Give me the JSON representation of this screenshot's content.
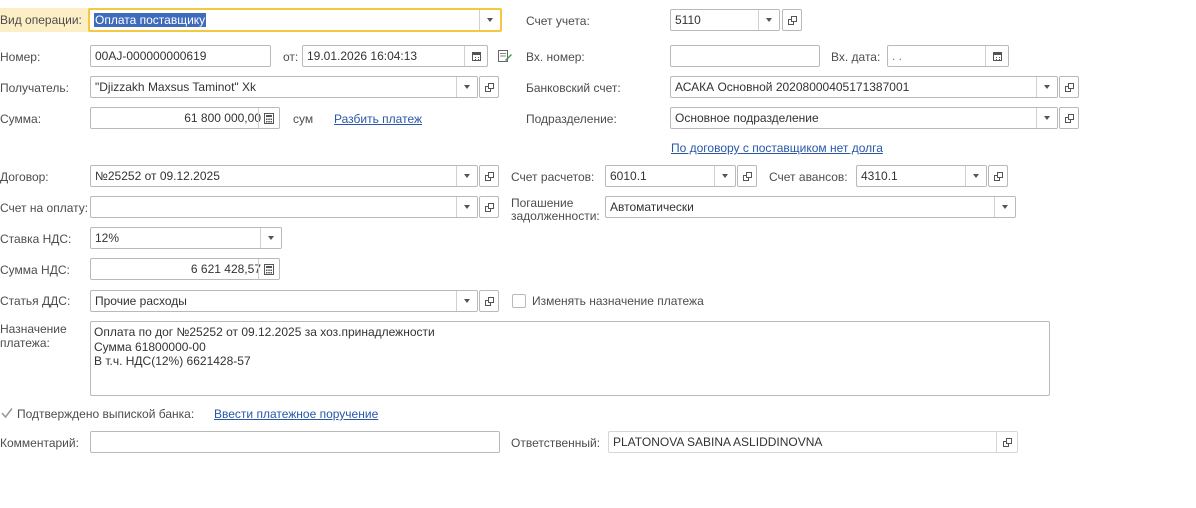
{
  "row1": {
    "op_type_label": "Вид операции:",
    "op_type_value": "Оплата поставщику",
    "account_label": "Счет учета:",
    "account_value": "5110"
  },
  "row2": {
    "number_label": "Номер:",
    "number_value": "00AJ-000000000619",
    "from_label": "от:",
    "date_value": "19.01.2026 16:04:13",
    "in_number_label": "Вх. номер:",
    "in_number_value": "",
    "in_date_label": "Вх. дата:",
    "in_date_value": " .  ."
  },
  "row3": {
    "recipient_label": "Получатель:",
    "recipient_value": "\"Djizzakh Maxsus Taminot\" Xk",
    "bank_account_label": "Банковский счет:",
    "bank_account_value": "АСАКА Основной 20208000405171387001"
  },
  "row4": {
    "sum_label": "Сумма:",
    "sum_value": "61 800 000,00",
    "currency": "сум",
    "split_link": "Разбить платеж",
    "division_label": "Подразделение:",
    "division_value": "Основное подразделение",
    "debt_link": "По договору с поставщиком нет долга"
  },
  "row5": {
    "contract_label": "Договор:",
    "contract_value": "№25252 от 09.12.2025",
    "settle_account_label": "Счет расчетов:",
    "settle_account_value": "6010.1",
    "advance_account_label": "Счет авансов:",
    "advance_account_value": "4310.1"
  },
  "row6": {
    "invoice_label": "Счет на оплату:",
    "invoice_value": "",
    "repay_label_1": "Погашение",
    "repay_label_2": "задолженности:",
    "repay_value": "Автоматически"
  },
  "row7": {
    "vat_rate_label": "Ставка НДС:",
    "vat_rate_value": "12%"
  },
  "row8": {
    "vat_sum_label": "Сумма НДС:",
    "vat_sum_value": "6 621 428,57"
  },
  "row9": {
    "cashflow_label": "Статья ДДС:",
    "cashflow_value": "Прочие расходы",
    "change_purpose_label": "Изменять назначение платежа"
  },
  "purpose": {
    "label_1": "Назначение",
    "label_2": "платежа:",
    "lines": [
      "Оплата по дог №25252 от 09.12.2025 за хоз.принадлежности",
      "Сумма 61800000-00",
      "В т.ч. НДС(12%) 6621428-57"
    ]
  },
  "confirm": {
    "label": "Подтверждено выпиской банка:",
    "checked": true,
    "link": "Ввести платежное поручение"
  },
  "bottom": {
    "comment_label": "Комментарий:",
    "comment_value": "",
    "responsible_label": "Ответственный:",
    "responsible_value": "PLATONOVA SABINA ASLIDDINOVNA"
  },
  "colors": {
    "link": "#2a56a8",
    "focus_border": "#f5c842",
    "label_highlight": "#fcefc6",
    "selection": "#3f6bbd"
  }
}
